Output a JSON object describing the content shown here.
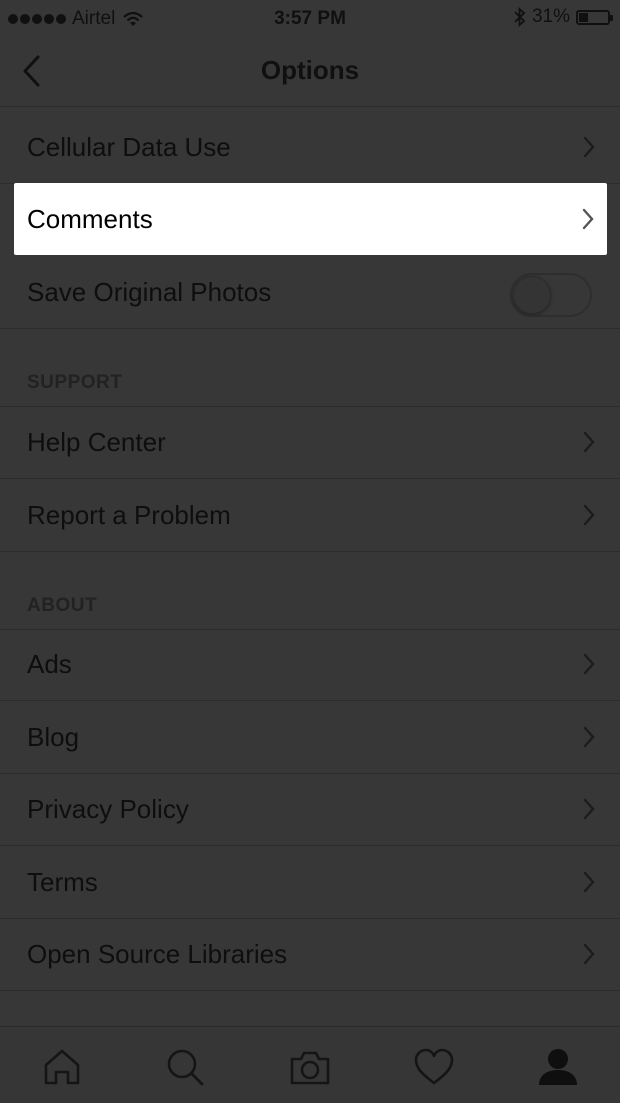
{
  "status_bar": {
    "carrier": "Airtel",
    "time": "3:57 PM",
    "battery": "31%",
    "signal_icon": "signal-dots-icon",
    "wifi_icon": "wifi-icon",
    "bluetooth_icon": "bluetooth-icon",
    "battery_icon": "battery-icon"
  },
  "nav": {
    "title": "Options",
    "back_icon": "chevron-left-icon"
  },
  "rows_top": [
    {
      "label": "Cellular Data Use",
      "type": "link"
    },
    {
      "label": "Comments",
      "type": "link",
      "highlighted": true
    },
    {
      "label": "Save Original Photos",
      "type": "toggle",
      "on": false
    }
  ],
  "sections": {
    "support": {
      "header": "SUPPORT",
      "items": [
        "Help Center",
        "Report a Problem"
      ]
    },
    "about": {
      "header": "ABOUT",
      "items": [
        "Ads",
        "Blog",
        "Privacy Policy",
        "Terms",
        "Open Source Libraries"
      ]
    }
  },
  "tab_bar": {
    "tabs": [
      "home-icon",
      "search-icon",
      "camera-icon",
      "heart-icon",
      "profile-icon"
    ],
    "active": "profile-icon"
  },
  "colors": {
    "background": "#373737",
    "highlight": "#ffffff",
    "text": "#0e0e0e"
  }
}
